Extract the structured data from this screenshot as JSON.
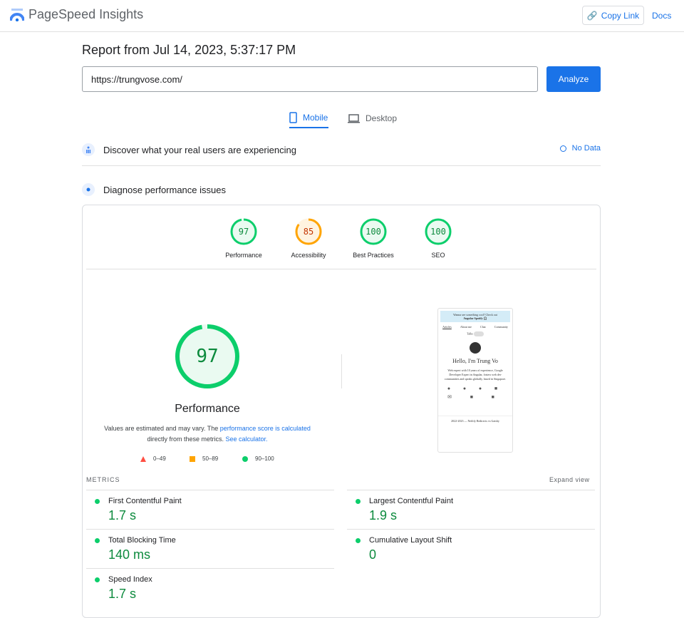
{
  "header": {
    "app_name": "PageSpeed Insights",
    "copy_link": "Copy Link",
    "docs": "Docs"
  },
  "report_title": "Report from Jul 14, 2023, 5:37:17 PM",
  "url_input": {
    "value": "https://trungvose.com/"
  },
  "analyze": "Analyze",
  "tabs": [
    {
      "label": "Mobile",
      "active": true
    },
    {
      "label": "Desktop",
      "active": false
    }
  ],
  "sections": {
    "real_users": "Discover what your real users are experiencing",
    "no_data": "No Data",
    "diagnose": "Diagnose performance issues"
  },
  "scores": [
    {
      "label": "Performance",
      "value": "97",
      "score": 97,
      "color": "#0cce6b"
    },
    {
      "label": "Accessibility",
      "value": "85",
      "score": 85,
      "color": "#ffa400"
    },
    {
      "label": "Best Practices",
      "value": "100",
      "score": 100,
      "color": "#0cce6b"
    },
    {
      "label": "SEO",
      "value": "100",
      "score": 100,
      "color": "#0cce6b"
    }
  ],
  "main_score": {
    "value": "97",
    "score": 97,
    "label": "Performance",
    "desc_prefix": "Values are estimated and may vary. The ",
    "desc_link": "performance score is calculated",
    "desc_mid": " directly from these metrics. ",
    "desc_link2": "See calculator."
  },
  "legend": [
    {
      "range": "0–49",
      "color": "#ff4e42"
    },
    {
      "range": "50–89",
      "color": "#ffa400"
    },
    {
      "range": "90–100",
      "color": "#0cce6b"
    }
  ],
  "screenshot": {
    "banner": "Wanna see something cool? Check out",
    "banner_link": "Angular Spotify 🎧",
    "nav": [
      "Articles",
      "About me",
      "Chat",
      "Community"
    ],
    "talks": "Talks",
    "hello": "Hello, I'm Trung Vo",
    "bio": "Web expert with 10 years of experience, Google Developer Expert in Angular, fosters web dev communities and speaks globally, based in Singapore.",
    "footer": "2022-2023 — Netlify Redirects vs Gatsby"
  },
  "metrics": {
    "heading": "METRICS",
    "expand": "Expand view",
    "items": [
      {
        "name": "First Contentful Paint",
        "value": "1.7 s"
      },
      {
        "name": "Largest Contentful Paint",
        "value": "1.9 s"
      },
      {
        "name": "Total Blocking Time",
        "value": "140 ms"
      },
      {
        "name": "Cumulative Layout Shift",
        "value": "0"
      },
      {
        "name": "Speed Index",
        "value": "1.7 s"
      }
    ]
  }
}
